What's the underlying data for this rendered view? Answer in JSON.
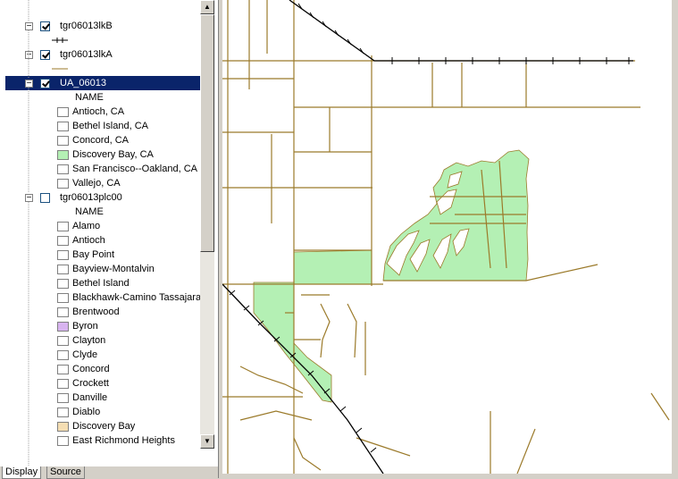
{
  "toc": {
    "layers": [
      {
        "name": "tgr06013lkB",
        "checked": true,
        "symbol": "railroad-line"
      },
      {
        "name": "tgr06013lkA",
        "checked": true,
        "symbol": "road-line"
      },
      {
        "name": "UA_06013",
        "checked": true,
        "selected": true,
        "field": "NAME",
        "items": [
          {
            "label": "Antioch, CA",
            "color": "#ffffff"
          },
          {
            "label": "Bethel Island, CA",
            "color": "#ffffff"
          },
          {
            "label": "Concord, CA",
            "color": "#ffffff"
          },
          {
            "label": "Discovery Bay, CA",
            "color": "#b4f0b4"
          },
          {
            "label": "San Francisco--Oakland, CA",
            "color": "#ffffff"
          },
          {
            "label": "Vallejo, CA",
            "color": "#ffffff"
          }
        ]
      },
      {
        "name": "tgr06013plc00",
        "checked": false,
        "field": "NAME",
        "items": [
          {
            "label": "Alamo",
            "color": "#ffffff"
          },
          {
            "label": "Antioch",
            "color": "#ffffff"
          },
          {
            "label": "Bay Point",
            "color": "#ffffff"
          },
          {
            "label": "Bayview-Montalvin",
            "color": "#ffffff"
          },
          {
            "label": "Bethel Island",
            "color": "#ffffff"
          },
          {
            "label": "Blackhawk-Camino Tassajara",
            "color": "#ffffff"
          },
          {
            "label": "Brentwood",
            "color": "#ffffff"
          },
          {
            "label": "Byron",
            "color": "#d8b4f0"
          },
          {
            "label": "Clayton",
            "color": "#ffffff"
          },
          {
            "label": "Clyde",
            "color": "#ffffff"
          },
          {
            "label": "Concord",
            "color": "#ffffff"
          },
          {
            "label": "Crockett",
            "color": "#ffffff"
          },
          {
            "label": "Danville",
            "color": "#ffffff"
          },
          {
            "label": "Diablo",
            "color": "#ffffff"
          },
          {
            "label": "Discovery Bay",
            "color": "#f5deb3"
          },
          {
            "label": "East Richmond Heights",
            "color": "#ffffff"
          }
        ]
      }
    ],
    "expander_minus": "⊟"
  },
  "tabs": [
    "Display",
    "Source"
  ],
  "map": {
    "road_color": "#9b7a2a",
    "rail_color": "#000000",
    "urban_fill": "#b4f0b4"
  },
  "icons": {
    "scroll_up": "▲",
    "scroll_down": "▼"
  }
}
